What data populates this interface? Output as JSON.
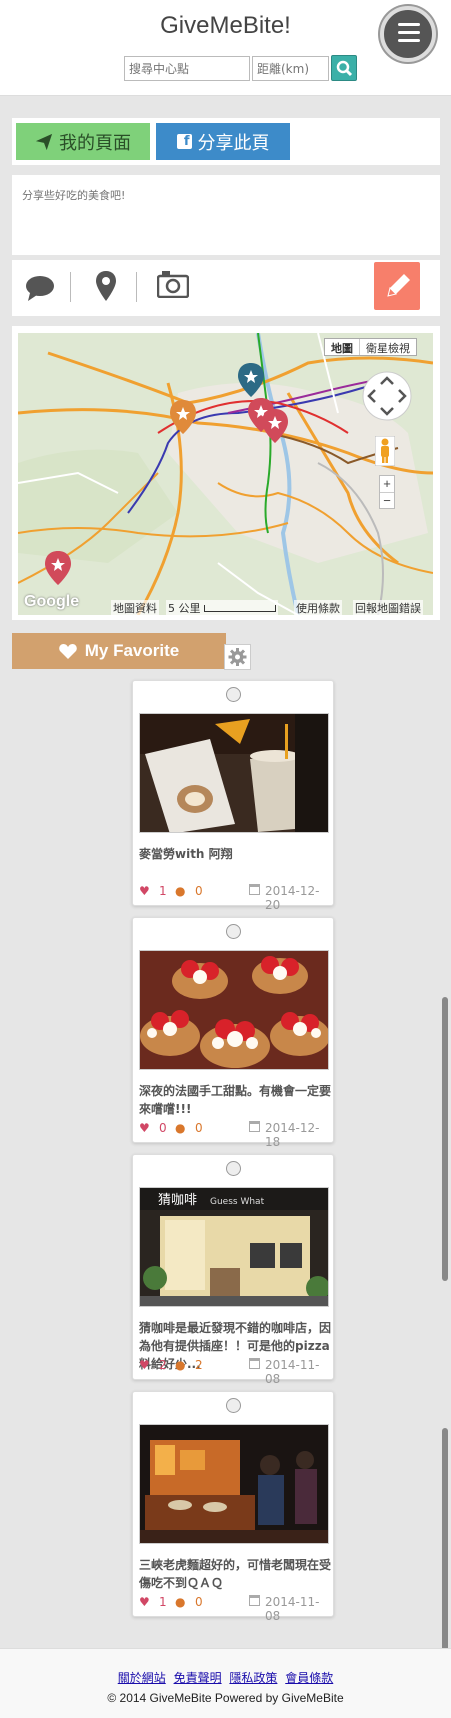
{
  "header": {
    "title": "GiveMeBite!",
    "search_placeholder": "搜尋中心點",
    "distance_placeholder": "距離(km)"
  },
  "actions": {
    "my_page": "我的頁面",
    "share_page": "分享此頁"
  },
  "post": {
    "placeholder": "分享些好吃的美食吧!"
  },
  "map": {
    "type_map": "地圖",
    "type_satellite": "衛星檢視",
    "attribution": "地圖資料",
    "scale": "5 公里",
    "terms": "使用條款",
    "report": "回報地圖錯誤",
    "logo": "Google"
  },
  "favorites": {
    "title": "My Favorite",
    "cards": [
      {
        "title": "麥當勞with 阿翔",
        "likes": "1",
        "comments": "0",
        "date": "2014-12-20"
      },
      {
        "title": "深夜的法國手工甜點。有機會一定要來嚐嚐!!!",
        "likes": "0",
        "comments": "0",
        "date": "2014-12-18"
      },
      {
        "title": "猜咖啡是最近發現不錯的咖啡店，因為他有提供插座！！可是他的pizza料給好少...",
        "likes": "2",
        "comments": "2",
        "date": "2014-11-08"
      },
      {
        "title": "三峽老虎麵超好的，可惜老闆現在受傷吃不到ＱＡＱ",
        "likes": "1",
        "comments": "0",
        "date": "2014-11-08"
      }
    ]
  },
  "footer": {
    "links": [
      "關於網站",
      "免責聲明",
      "隱私政策",
      "會員條款"
    ],
    "copyright": "© 2014 GiveMeBite Powered by GiveMeBite"
  }
}
